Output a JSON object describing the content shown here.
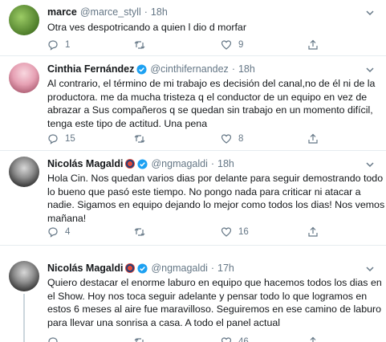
{
  "tweets": [
    {
      "name": "marce",
      "handle": "@marce_styll",
      "time": "18h",
      "text": [
        "Otra ves despotricando a quien l dio d morfar"
      ],
      "replies": "1",
      "retweets": "",
      "likes": "9",
      "verified": false
    },
    {
      "name": "Cinthia Fernández",
      "handle": "@cinthifernandez",
      "time": "18h",
      "text": [
        "Al contrario, el término de mi trabajo es decisión del canal,no de él ni de la",
        "productora. me da mucha tristeza q el conductor de un equipo en vez de",
        "abrazar a Sus compañeros q se quedan sin trabajo en un momento difícil,",
        "tenga este tipo de actitud. Una pena"
      ],
      "replies": "15",
      "retweets": "",
      "likes": "8",
      "verified": true
    },
    {
      "name": "Nicolás Magaldi",
      "handle": "@ngmagaldi",
      "time": "18h",
      "text": [
        "Hola Cin. Nos quedan varios dias por delante para seguir demostrando todo",
        "lo bueno que pasó este tiempo. No pongo nada para criticar ni atacar a",
        "nadie. Sigamos en equipo dejando lo mejor como todos los dias! Nos vemos",
        "mañana!"
      ],
      "replies": "4",
      "retweets": "",
      "likes": "16",
      "verified": true
    },
    {
      "name": "Nicolás Magaldi",
      "handle": "@ngmagaldi",
      "time": "17h",
      "text": [
        "Quiero destacar el enorme laburo en equipo que hacemos todos los dias en",
        "el Show. Hoy nos toca seguir adelante y pensar todo lo que logramos en",
        "estos 6 meses al aire fue maravilloso. Seguiremos en ese camino de laburo",
        "para llevar una sonrisa a casa. A todo el panel actual"
      ],
      "replies": "",
      "retweets": "",
      "likes": "46",
      "verified": true
    }
  ],
  "separator_dot": "·",
  "colors": {
    "verified": "#1da1f2",
    "meta": "#657786",
    "text": "#14171a"
  }
}
